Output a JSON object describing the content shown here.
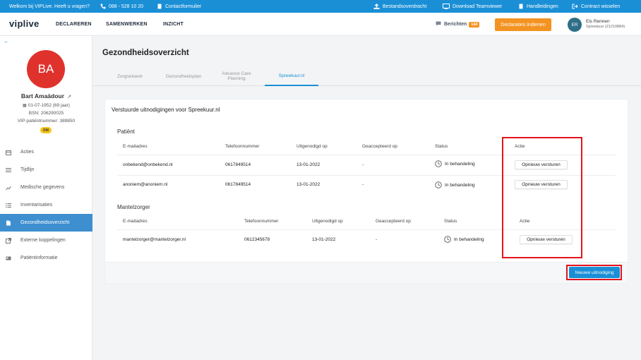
{
  "topbar": {
    "welcome": "Welkom bij VIPLive. Heeft u vragen?",
    "phone": "088 - 528 10 20",
    "contact": "Contactformulier",
    "bestandsoverdracht": "Bestandsoverdracht",
    "teamviewer": "Download Teamviewer",
    "handleidingen": "Handleidingen",
    "contract": "Contract wisselen"
  },
  "nav": {
    "logo": "viplive",
    "links": [
      "DECLAREREN",
      "SAMENWERKEN",
      "INZICHT"
    ],
    "berichten_label": "Berichten",
    "berichten_count": "143",
    "declare_button": "Declaraties indienen",
    "user_initials": "ER",
    "user_name": "Els Rennen",
    "user_role": "Spreekuur (21210884)"
  },
  "patient": {
    "initials": "BA",
    "name": "Bart Amaädour",
    "dob": "01-07-1952  (69 jaar)",
    "bsn": "BSN: 206290025",
    "vip": "VIP-patiëntnummer: 389850",
    "badge": "DM"
  },
  "sidebar": {
    "items": [
      {
        "label": "Acties",
        "icon": "calendar-icon"
      },
      {
        "label": "Tijdlijn",
        "icon": "list-icon"
      },
      {
        "label": "Medische gegevens",
        "icon": "chart-icon"
      },
      {
        "label": "Inventarisaties",
        "icon": "checklist-icon"
      },
      {
        "label": "Gezondheidsoverzicht",
        "icon": "document-icon"
      },
      {
        "label": "Externe koppelingen",
        "icon": "external-link-icon"
      },
      {
        "label": "Patiëntinformatie",
        "icon": "id-card-icon"
      }
    ]
  },
  "main": {
    "title": "Gezondheidsoverzicht",
    "tabs": [
      "Zorgnetwerk",
      "Gezondheidsplan",
      "Advance Care Planning",
      "Spreekuur.nl"
    ],
    "card_title": "Verstuurde uitnodigingen voor Spreekuur.nl",
    "patient_section": {
      "title": "Patiënt",
      "headers": [
        "E-mailadres",
        "Telefoonnummer",
        "Uitgenodigd op",
        "Geaccepteerd op",
        "Status",
        "Actie"
      ],
      "rows": [
        {
          "email": "onbekend@onbekend.nl",
          "phone": "0617849514",
          "invited": "13-01-2022",
          "accepted": "-",
          "status": "In behandeling",
          "action": "Opnieuw versturen"
        },
        {
          "email": "anoniem@anoniem.nl",
          "phone": "0617849514",
          "invited": "13-01-2022",
          "accepted": "-",
          "status": "In behandeling",
          "action": "Opnieuw versturen"
        }
      ]
    },
    "caregiver_section": {
      "title": "Mantelzorger",
      "headers": [
        "E-mailadres",
        "Telefoonnummer",
        "Uitgenodigd op",
        "Geaccepteerd op",
        "Status",
        "Actie"
      ],
      "rows": [
        {
          "email": "mantelzorger@mantelzorger.nl",
          "phone": "0612345678",
          "invited": "13-01-2022",
          "accepted": "-",
          "status": "In behandeling",
          "action": "Opnieuw versturen"
        }
      ]
    },
    "new_button": "Nieuwe uitnodiging"
  },
  "colors": {
    "primary": "#1a8fd6",
    "accent": "#f39321",
    "avatar": "#e0322d",
    "highlight": "#e3141c"
  }
}
